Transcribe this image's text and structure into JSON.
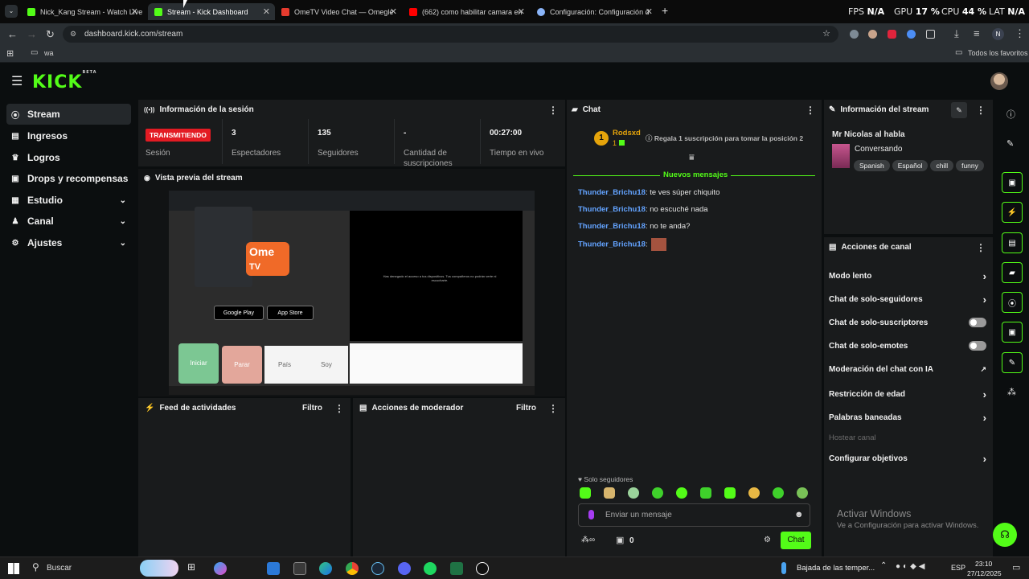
{
  "browser": {
    "tabs": [
      {
        "label": "Nick_Kang Stream - Watch Live",
        "color": "#53fc18"
      },
      {
        "label": "Stream - Kick Dashboard",
        "color": "#53fc18"
      },
      {
        "label": "OmeTV Video Chat — Omegle",
        "color": "#e63b2e"
      },
      {
        "label": "(662) como habilitar camara en",
        "color": "#ff0000"
      },
      {
        "label": "Configuración: Configuración d",
        "color": "#8ab4f8"
      }
    ],
    "perf": {
      "fps_label": "FPS",
      "fps_val": "N/A",
      "gpu_label": "GPU",
      "gpu_val": "17 %",
      "cpu_label": "CPU",
      "cpu_val": "44 %",
      "lat_label": "LAT",
      "lat_val": "N/A"
    },
    "url": "dashboard.kick.com/stream",
    "bookmark_folder": "wa",
    "all_bookmarks": "Todos los favoritos",
    "profile_initial": "N"
  },
  "app": {
    "logo": "KICK",
    "logo_badge": "BETA"
  },
  "sidebar": {
    "items": [
      {
        "label": "Stream",
        "icon": "broadcast-icon"
      },
      {
        "label": "Ingresos",
        "icon": "income-icon"
      },
      {
        "label": "Logros",
        "icon": "trophy-icon"
      },
      {
        "label": "Drops y recompensas",
        "icon": "gift-icon"
      },
      {
        "label": "Estudio",
        "icon": "studio-icon"
      },
      {
        "label": "Canal",
        "icon": "channel-icon"
      },
      {
        "label": "Ajustes",
        "icon": "gear-icon"
      }
    ]
  },
  "session": {
    "title": "Información de la sesión",
    "live_badge": "TRANSMITIENDO",
    "live_label": "Sesión",
    "stats": [
      {
        "value": "3",
        "label": "Espectadores"
      },
      {
        "value": "135",
        "label": "Seguidores"
      },
      {
        "value": "-",
        "label": "Cantidad de suscripciones"
      },
      {
        "value": "00:27:00",
        "label": "Tiempo en vivo"
      }
    ]
  },
  "preview": {
    "title": "Vista previa del stream",
    "brand": "Ome",
    "brand_sub": "TV",
    "store1": "Google Play",
    "store2": "App Store",
    "buttons": [
      "Iniciar",
      "Parar",
      "País",
      "Soy"
    ],
    "notice": "Has denegado el acceso a tus dispositivos. Tus compañeros no podrán verte ni escucharte."
  },
  "feed": {
    "title": "Feed de actividades",
    "filter": "Filtro"
  },
  "modactions": {
    "title": "Acciones de moderador",
    "filter": "Filtro"
  },
  "chat": {
    "title": "Chat",
    "top_user": "Rodsxd",
    "top_rank": "1",
    "gift_text": "Regala 1 suscripción para tomar la posición 2",
    "new_messages": "Nuevos mensajes",
    "messages": [
      {
        "user": "Thunder_Brichu18",
        "text": ": te ves súper chiquito"
      },
      {
        "user": "Thunder_Brichu18",
        "text": ": no escuché nada"
      },
      {
        "user": "Thunder_Brichu18",
        "text": ": no te anda?"
      },
      {
        "user": "Thunder_Brichu18",
        "text": ":"
      }
    ],
    "followers_only": "Solo seguidores",
    "input_placeholder": "Enviar un mensaje",
    "points": "0",
    "send": "Chat"
  },
  "streaminfo": {
    "title": "Información del stream",
    "stream_title": "Mr Nicolas al habla",
    "category": "Conversando",
    "tags": [
      "Spanish",
      "Español",
      "chill",
      "funny"
    ]
  },
  "channelactions": {
    "title": "Acciones de canal",
    "rows": [
      {
        "label": "Modo lento",
        "kind": "chevron"
      },
      {
        "label": "Chat de solo-seguidores",
        "kind": "chevron"
      },
      {
        "label": "Chat de solo-suscriptores",
        "kind": "toggle"
      },
      {
        "label": "Chat de solo-emotes",
        "kind": "toggle"
      },
      {
        "label": "Moderación del chat con IA",
        "kind": "link"
      },
      {
        "label": "Restricción de edad",
        "kind": "chevron"
      },
      {
        "label": "Palabras baneadas",
        "kind": "chevron"
      },
      {
        "label": "Hostear canal",
        "kind": "disabled"
      },
      {
        "label": "Configurar objetivos",
        "kind": "chevron"
      }
    ]
  },
  "windows_watermark": {
    "title": "Activar Windows",
    "subtitle": "Ve a Configuración para activar Windows."
  },
  "taskbar": {
    "search": "Buscar",
    "weather": "Bajada de las temper...",
    "lang": "ESP",
    "time": "23:10",
    "date": "27/12/2025"
  },
  "colors": {
    "accent": "#53fc18",
    "live": "#e31b23",
    "link": "#63a3ff"
  }
}
